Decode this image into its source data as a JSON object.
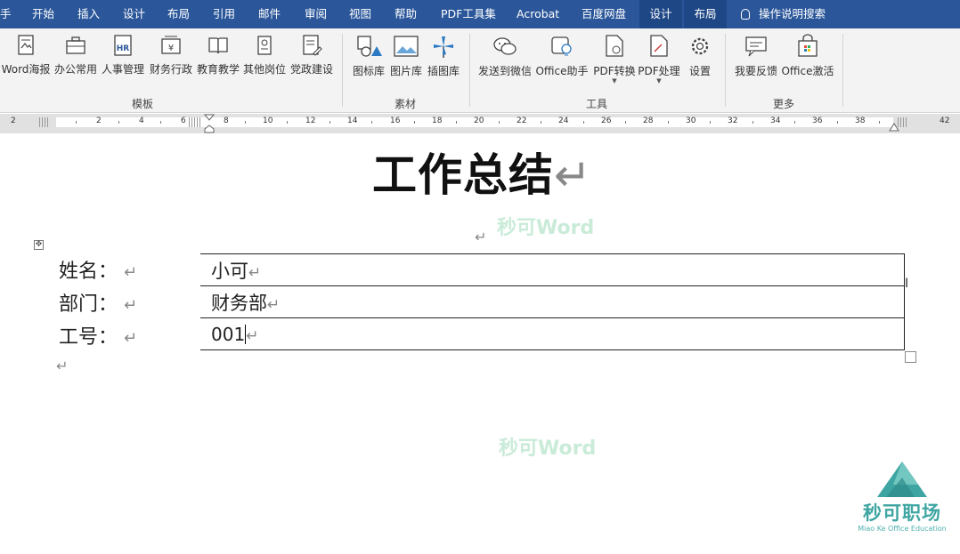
{
  "tabs": {
    "partial": "手",
    "items": [
      "开始",
      "插入",
      "设计",
      "布局",
      "引用",
      "邮件",
      "审阅",
      "视图",
      "帮助",
      "PDF工具集",
      "Acrobat",
      "百度网盘"
    ],
    "context": [
      "设计",
      "布局"
    ],
    "tell_me": "操作说明搜索"
  },
  "ribbon": {
    "template_buttons": [
      "Word海报",
      "办公常用",
      "人事管理",
      "财务行政",
      "教育教学",
      "其他岗位",
      "党政建设"
    ],
    "material_buttons": [
      "图标库",
      "图片库",
      "插图库"
    ],
    "tool_buttons": [
      "发送到微信",
      "Office助手",
      "PDF转换",
      "PDF处理",
      "设置"
    ],
    "more_buttons": [
      "我要反馈",
      "Office激活"
    ],
    "groups": [
      "模板",
      "素材",
      "工具",
      "更多"
    ]
  },
  "ruler": {
    "numbers": [
      "2",
      "2",
      "4",
      "6",
      "8",
      "10",
      "12",
      "14",
      "16",
      "18",
      "20",
      "22",
      "24",
      "26",
      "28",
      "30",
      "32",
      "34",
      "36",
      "38",
      "42"
    ]
  },
  "document": {
    "title": "工作总结",
    "watermark": "秒可Word",
    "para_mark": "↵",
    "fields": [
      {
        "label": "姓名：",
        "value": "小可"
      },
      {
        "label": "部门：",
        "value": "财务部"
      },
      {
        "label": "工号：",
        "value": "001"
      }
    ]
  },
  "logo": {
    "name": "秒可职场",
    "subtitle": "Miao Ke Office Education",
    "color": "#3fa5a2"
  },
  "colors": {
    "tabbar": "#2b579a",
    "ribbon": "#f3f3f3"
  }
}
